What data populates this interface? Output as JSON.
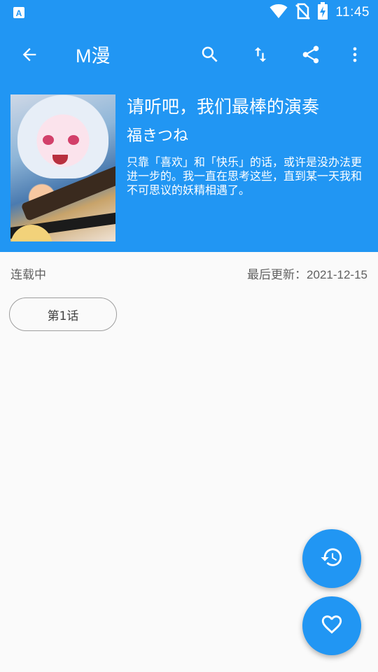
{
  "status_bar": {
    "time": "11:45",
    "icons": [
      "app-notification-icon",
      "wifi-icon",
      "no-sim-icon",
      "battery-charging-icon"
    ]
  },
  "app_bar": {
    "title": "M漫",
    "actions": [
      "back-icon",
      "search-icon",
      "sort-icon",
      "share-icon",
      "more-vert-icon"
    ]
  },
  "comic": {
    "title": "请听吧，我们最棒的演奏",
    "author": "福きつね",
    "description": "只靠「喜欢」和「快乐」的话，或许是没办法更进一步的。我一直在思考这些，直到某一天我和不可思议的妖精相遇了。"
  },
  "meta": {
    "status": "连载中",
    "last_update": "最后更新：2021-12-15"
  },
  "chapters": [
    {
      "label": "第1话"
    }
  ],
  "fabs": [
    "history-icon",
    "favorite-icon"
  ],
  "colors": {
    "primary": "#2196f3",
    "background": "#fafafa",
    "secondary_text": "#616161"
  }
}
